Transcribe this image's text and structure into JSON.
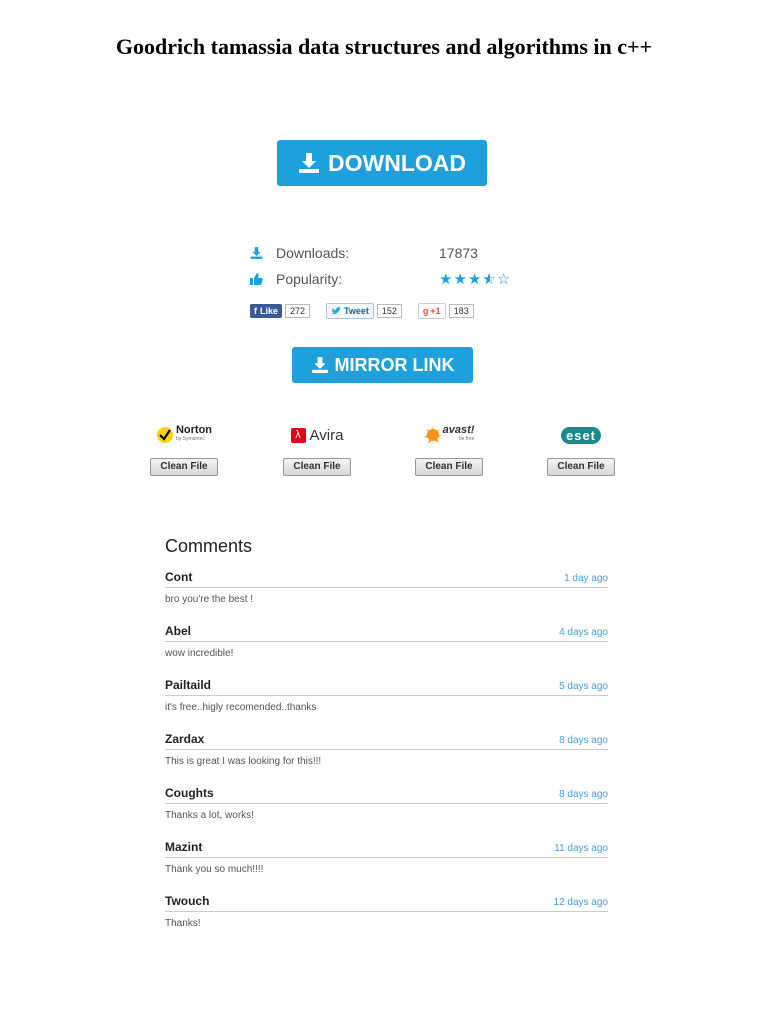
{
  "title": "Goodrich tamassia data structures and algorithms in c++",
  "download_button": {
    "label": "DOWNLOAD"
  },
  "stats": {
    "downloads_label": "Downloads:",
    "downloads_value": "17873",
    "popularity_label": "Popularity:",
    "popularity_rating": 3.5,
    "popularity_max": 5
  },
  "social": {
    "facebook": {
      "label": "Like",
      "count": "272"
    },
    "twitter": {
      "label": "Tweet",
      "count": "152"
    },
    "googleplus": {
      "label": "+1",
      "count": "183"
    }
  },
  "mirror_button": {
    "label": "MIRROR LINK"
  },
  "antivirus": [
    {
      "name": "Norton",
      "sub": "by Symantec",
      "status": "Clean File"
    },
    {
      "name": "Avira",
      "status": "Clean File"
    },
    {
      "name": "avast!",
      "sub": "be free",
      "status": "Clean File"
    },
    {
      "name": "eset",
      "status": "Clean File"
    }
  ],
  "comments": {
    "heading": "Comments",
    "items": [
      {
        "author": "Cont",
        "time": "1 day ago",
        "text": "bro you're the best !"
      },
      {
        "author": "Abel",
        "time": "4 days ago",
        "text": "wow incredible!"
      },
      {
        "author": "Pailtaild",
        "time": "5 days ago",
        "text": "it's free..higly recomended..thanks"
      },
      {
        "author": "Zardax",
        "time": "8 days ago",
        "text": "This is great I was looking for this!!!"
      },
      {
        "author": "Coughts",
        "time": "8 days ago",
        "text": "Thanks a lot, works!"
      },
      {
        "author": "Mazint",
        "time": "11 days ago",
        "text": "Thank you so much!!!!"
      },
      {
        "author": "Twouch",
        "time": "12 days ago",
        "text": "Thanks!"
      }
    ]
  },
  "colors": {
    "accent": "#1ea0dc",
    "link": "#4a9ed6",
    "facebook": "#3b5998"
  }
}
